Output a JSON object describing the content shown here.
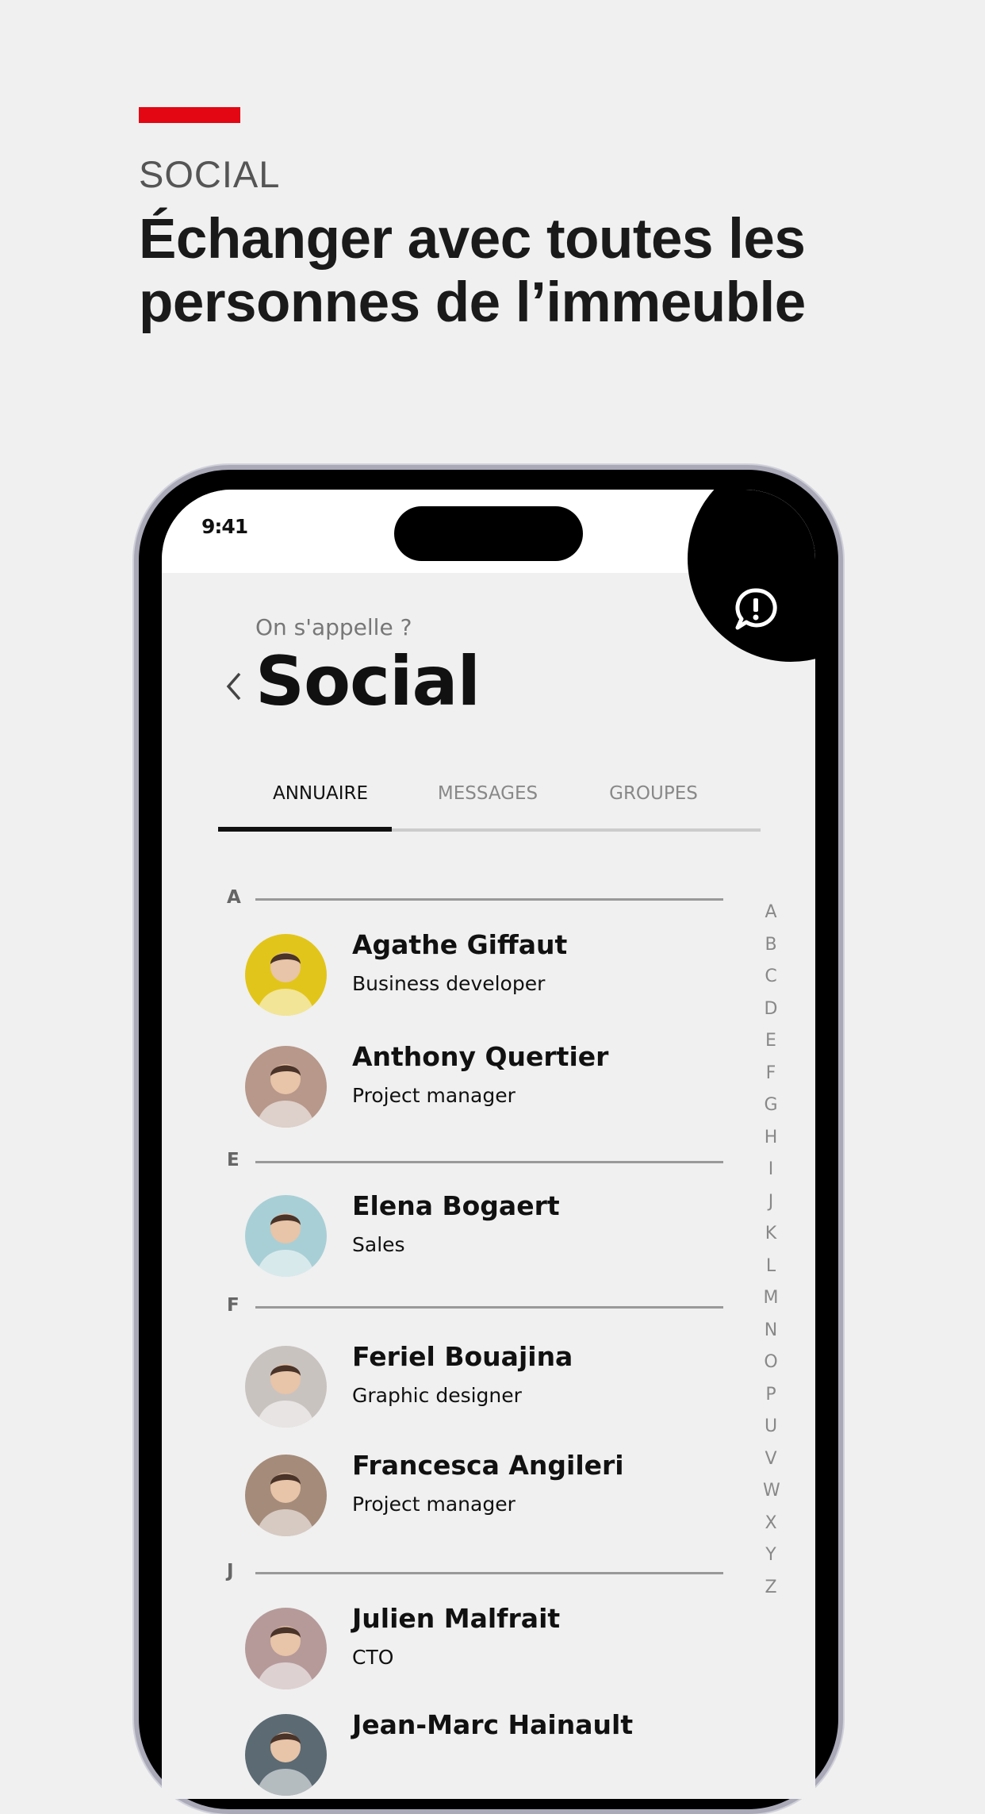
{
  "header": {
    "kicker": "SOCIAL",
    "headline": "Échanger avec toutes les personnes de l’immeuble",
    "accent_color": "#e30613"
  },
  "status_bar": {
    "time": "9:41"
  },
  "app": {
    "subtitle": "On s'appelle ?",
    "title": "Social",
    "report_icon": "chat-alert-icon",
    "tabs": [
      {
        "label": "ANNUAIRE",
        "active": true
      },
      {
        "label": "MESSAGES",
        "active": false
      },
      {
        "label": "GROUPES",
        "active": false
      }
    ],
    "sections": [
      {
        "letter": "A",
        "contacts": [
          {
            "name": "Agathe Giffaut",
            "role": "Business developer",
            "color": "#e2c51a"
          },
          {
            "name": "Anthony Quertier",
            "role": "Project manager",
            "color": "#b7988a"
          }
        ]
      },
      {
        "letter": "E",
        "contacts": [
          {
            "name": "Elena Bogaert",
            "role": "Sales",
            "color": "#a9cfd6"
          }
        ]
      },
      {
        "letter": "F",
        "contacts": [
          {
            "name": "Feriel Bouajina",
            "role": "Graphic designer",
            "color": "#c9c3c0"
          },
          {
            "name": "Francesca Angileri",
            "role": "Project manager",
            "color": "#a58b7a"
          }
        ]
      },
      {
        "letter": "J",
        "contacts": [
          {
            "name": "Julien Malfrait",
            "role": "CTO",
            "color": "#b69a9a"
          },
          {
            "name": "Jean-Marc Hainault",
            "role": "",
            "color": "#5b6a73"
          }
        ]
      }
    ],
    "alphabet": [
      "A",
      "B",
      "C",
      "D",
      "E",
      "F",
      "G",
      "H",
      "I",
      "J",
      "K",
      "L",
      "M",
      "N",
      "O",
      "P",
      "U",
      "V",
      "W",
      "X",
      "Y",
      "Z"
    ]
  }
}
